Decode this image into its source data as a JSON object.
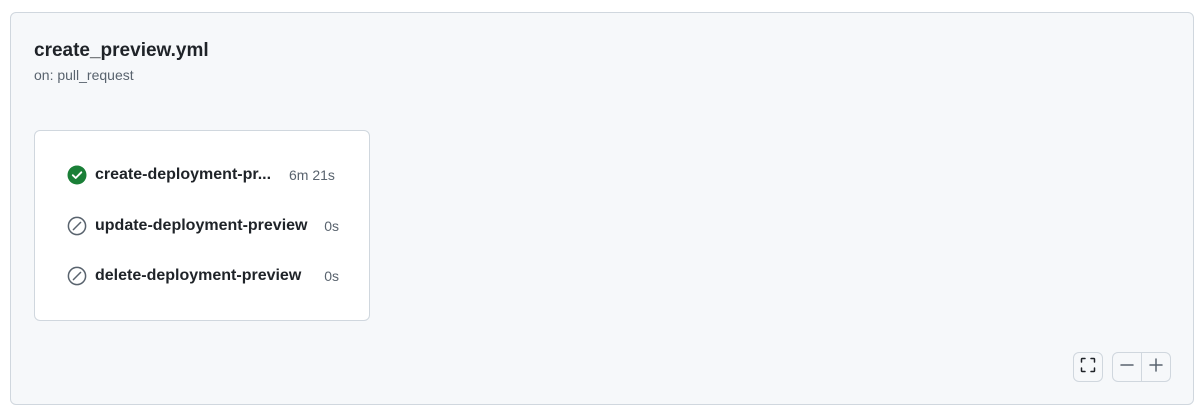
{
  "workflow": {
    "title": "create_preview.yml",
    "trigger": "on: pull_request"
  },
  "jobs": [
    {
      "name": "create-deployment-pr...",
      "duration": "6m 21s",
      "status": "success",
      "icon": "check-circle-fill-icon"
    },
    {
      "name": "update-deployment-preview",
      "duration": "0s",
      "status": "skipped",
      "icon": "skip-icon"
    },
    {
      "name": "delete-deployment-preview",
      "duration": "0s",
      "status": "skipped",
      "icon": "skip-icon"
    }
  ],
  "controls": {
    "fullscreen_icon": "screen-full-icon",
    "zoom_out_icon": "dash-icon",
    "zoom_in_icon": "plus-icon"
  },
  "colors": {
    "success": "#1a7f37",
    "skipped": "#59636e",
    "panel_background": "#f6f8fa",
    "border": "#d0d7de"
  }
}
